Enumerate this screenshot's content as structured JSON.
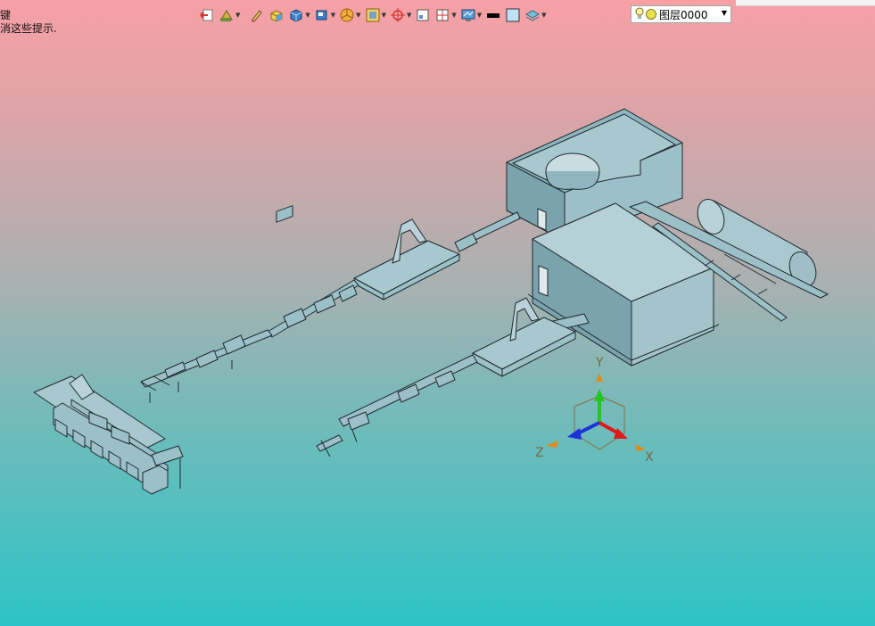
{
  "hint": {
    "line1": "键",
    "line2": "消这些提示."
  },
  "toolbar": {
    "icons": [
      {
        "name": "exit-sketch-icon",
        "dropdown": false
      },
      {
        "name": "sketch-tools-icon",
        "dropdown": true
      },
      {
        "name": "pencil-icon",
        "dropdown": false
      },
      {
        "name": "face-shade-icon",
        "dropdown": false
      },
      {
        "name": "solid-box-icon",
        "dropdown": true
      },
      {
        "name": "view-cube-icon",
        "dropdown": true
      },
      {
        "name": "pie-section-icon",
        "dropdown": true
      },
      {
        "name": "frame-select-icon",
        "dropdown": true
      },
      {
        "name": "target-snap-icon",
        "dropdown": true
      },
      {
        "name": "single-view-icon",
        "dropdown": false
      },
      {
        "name": "split-view-icon",
        "dropdown": true
      },
      {
        "name": "display-settings-icon",
        "dropdown": true
      },
      {
        "name": "line-style-icon",
        "dropdown": false
      },
      {
        "name": "color-swatch-icon",
        "dropdown": false
      },
      {
        "name": "layers-icon",
        "dropdown": true
      }
    ]
  },
  "layer": {
    "current": "图层0000"
  },
  "axes": {
    "x": "X",
    "y": "Y",
    "z": "Z"
  },
  "colors": {
    "bg_top": "#f7a0a5",
    "bg_bottom": "#2cc4c6",
    "model_fill": "#8fb5be",
    "model_stroke": "#1f2a2e"
  }
}
